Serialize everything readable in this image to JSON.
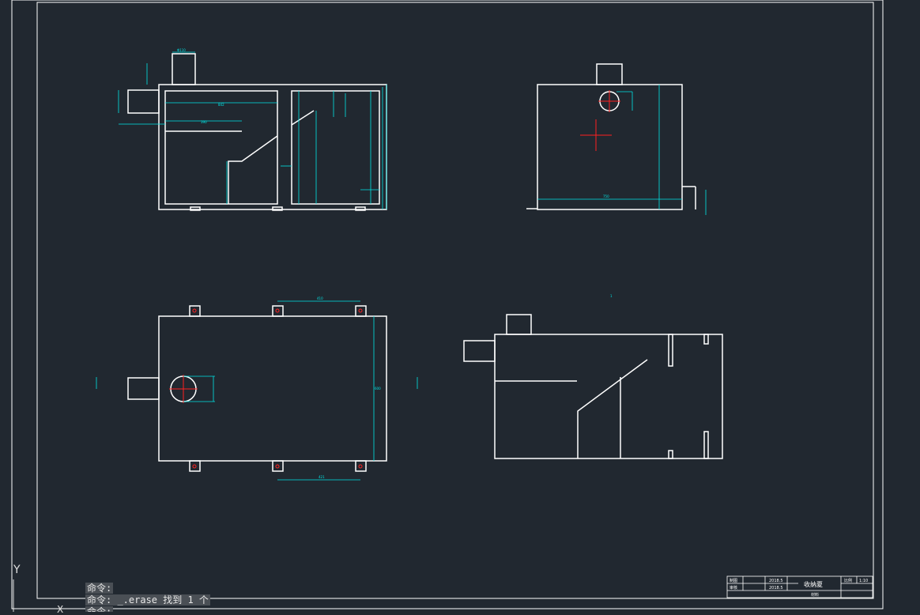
{
  "drawing": {
    "title_block": {
      "drawn_by_label": "制图",
      "checked_by_label": "审核",
      "date_1": "2018.5",
      "date_2": "2018.5",
      "part_name": "收纳夏",
      "scale_label": "比例",
      "scale_value": "1:10",
      "material_label": "材料"
    },
    "dimensions": {
      "front_pipe_width": "Φ110",
      "front_inner_length": "842",
      "front_baffle_length": "390",
      "side_bottom_width": "750",
      "side_height": "600",
      "top_spacing_top": "410",
      "top_spacing_bottom": "421",
      "top_depth": "600",
      "top_hole_dia": "Φ110",
      "section_mark": "1"
    },
    "colors": {
      "background": "#212830",
      "outline": "#ffffff",
      "dimension": "#00e5e5",
      "centerline": "#ff2020"
    }
  },
  "command": {
    "line1": "命令:",
    "line2": "命令: _.erase 找到 1 个",
    "line3": "命令:"
  },
  "ucs": {
    "y_label": "Y",
    "x_label": "X"
  }
}
